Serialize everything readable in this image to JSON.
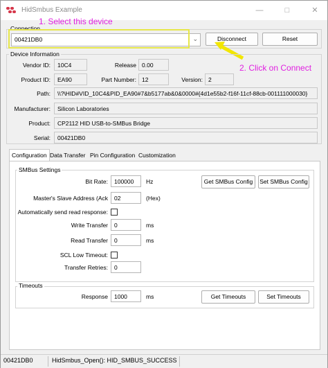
{
  "window": {
    "title": "HidSmbus Example"
  },
  "connection": {
    "group_label": "Connection",
    "device": "00421DB0",
    "disconnect_label": "Disconnect",
    "reset_label": "Reset"
  },
  "annotations": {
    "step1": "1. Select this device",
    "step2": "2. Click on Connect"
  },
  "device_info": {
    "group_label": "Device Information",
    "vendor_id_label": "Vendor ID:",
    "vendor_id": "10C4",
    "release_label": "Release",
    "release": "0.00",
    "product_id_label": "Product ID:",
    "product_id": "EA90",
    "part_number_label": "Part Number:",
    "part_number": "12",
    "version_label": "Version:",
    "version": "2",
    "path_label": "Path:",
    "path": "\\\\?\\HID#VID_10C4&PID_EA90#7&b5177ab&0&0000#{4d1e55b2-f16f-11cf-88cb-001111000030}",
    "manufacturer_label": "Manufacturer:",
    "manufacturer": "Silicon Laboratories",
    "product_label": "Product:",
    "product": "CP2112 HID USB-to-SMBus Bridge",
    "serial_label": "Serial:",
    "serial": "00421DB0"
  },
  "tabs": [
    "Configuration",
    "Data Transfer",
    "Pin Configuration",
    "Customization"
  ],
  "smbus": {
    "group_label": "SMBus Settings",
    "bit_rate_label": "Bit Rate:",
    "bit_rate": "100000",
    "bit_rate_unit": "Hz",
    "get_config_label": "Get SMBus Config",
    "set_config_label": "Set SMBus Config",
    "slave_address_label": "Master's Slave Address (Ack",
    "slave_address": "02",
    "slave_address_unit": "(Hex)",
    "auto_read_label": "Automatically send read response:",
    "write_transfer_label": "Write Transfer",
    "write_transfer": "0",
    "write_transfer_unit": "ms",
    "read_transfer_label": "Read Transfer",
    "read_transfer": "0",
    "read_transfer_unit": "ms",
    "scl_timeout_label": "SCL Low Timeout:",
    "transfer_retries_label": "Transfer Retries:",
    "transfer_retries": "0"
  },
  "timeouts": {
    "group_label": "Timeouts",
    "response_label": "Response",
    "response": "1000",
    "response_unit": "ms",
    "get_label": "Get Timeouts",
    "set_label": "Set Timeouts"
  },
  "status": {
    "device": "00421DB0",
    "message": "HidSmbus_Open(): HID_SMBUS_SUCCESS"
  },
  "colors": {
    "annotation": "#e020e0",
    "highlight": "#e6e64a",
    "arrow": "#f2e600"
  }
}
